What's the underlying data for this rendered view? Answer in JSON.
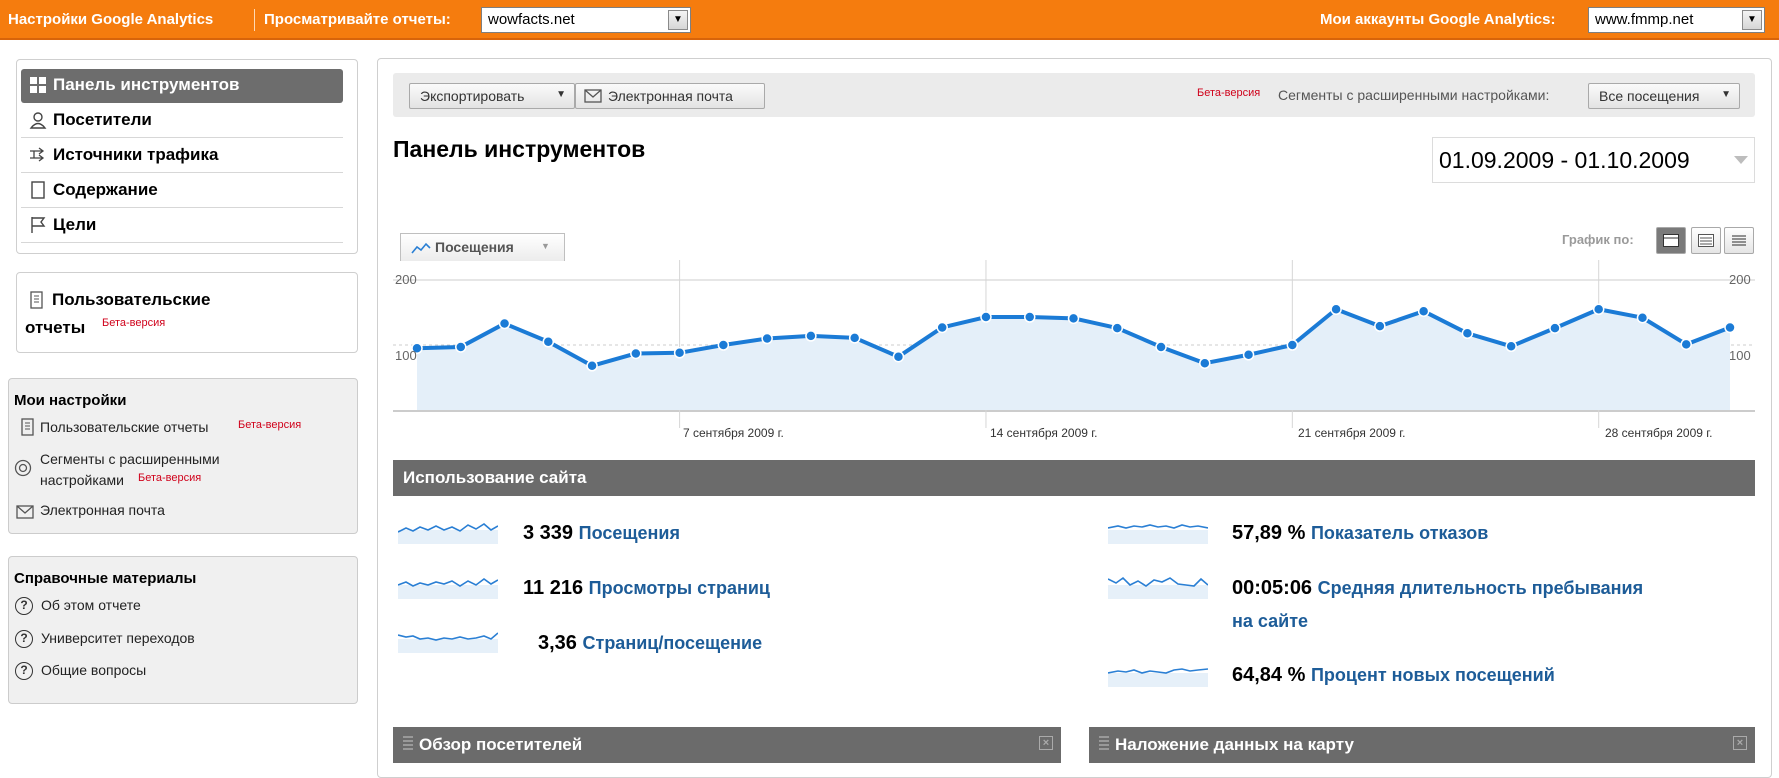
{
  "topbar": {
    "settings_link": "Настройки Google Analytics",
    "view_reports_label": "Просматривайте отчеты:",
    "report_site": "wowfacts.net",
    "accounts_label": "Мои аккаунты Google Analytics:",
    "account_site": "www.fmmp.net"
  },
  "nav": {
    "items": [
      {
        "label": "Панель инструментов"
      },
      {
        "label": "Посетители"
      },
      {
        "label": "Источники трафика"
      },
      {
        "label": "Содержание"
      },
      {
        "label": "Цели"
      }
    ]
  },
  "custom_reports": {
    "line1": "Пользовательские",
    "line2": "отчеты",
    "beta": "Бета-версия"
  },
  "my_settings": {
    "title": "Мои настройки",
    "custom_reports": "Пользовательские отчеты",
    "custom_reports_beta": "Бета-версия",
    "segments_line1": "Сегменты с расширенными",
    "segments_line2": "настройками",
    "segments_beta": "Бета-версия",
    "email": "Электронная почта"
  },
  "help": {
    "title": "Справочные материалы",
    "items": [
      "Об этом отчете",
      "Университет переходов",
      "Общие вопросы"
    ]
  },
  "toolbar": {
    "export": "Экспортировать",
    "email": "Электронная почта",
    "beta": "Бета-версия",
    "segments_label": "Сегменты с расширенными настройками:",
    "segments_value": "Все посещения"
  },
  "page": {
    "title": "Панель инструментов",
    "date_range": "01.09.2009 - 01.10.2009"
  },
  "graph": {
    "metric_tab": "Посещения",
    "graph_by": "График по:",
    "y_top_left": "200",
    "y_mid_left": "100",
    "y_top_right": "200",
    "y_mid_right": "100",
    "dates": [
      "7 сентября 2009 г.",
      "14 сентября 2009 г.",
      "21 сентября 2009 г.",
      "28 сентября 2009 г."
    ]
  },
  "chart_data": {
    "type": "area",
    "series": [
      {
        "name": "Посещения",
        "values": [
          95,
          97,
          133,
          105,
          68,
          87,
          88,
          100,
          110,
          114,
          111,
          82,
          127,
          143,
          143,
          141,
          126,
          97,
          72,
          85,
          100,
          155,
          129,
          152,
          118,
          98,
          126,
          155,
          142,
          101,
          127
        ]
      }
    ],
    "ylim": [
      0,
      200
    ],
    "yticks": [
      100,
      200
    ],
    "grid": true
  },
  "site_usage": {
    "title": "Использование сайта",
    "stats": [
      {
        "value": "3 339",
        "label": "Посещения"
      },
      {
        "value": "11 216",
        "label": "Просмотры страниц"
      },
      {
        "value": "3,36",
        "label": "Страниц/посещение"
      },
      {
        "value": "57,89 %",
        "label": "Показатель отказов"
      },
      {
        "value": "00:05:06",
        "label_line1": "Средняя длительность пребывания",
        "label_line2": "на сайте"
      },
      {
        "value": "64,84 %",
        "label": "Процент новых посещений"
      }
    ]
  },
  "panels": {
    "visitors_overview": "Обзор посетителей",
    "map_overlay": "Наложение данных на карту"
  }
}
